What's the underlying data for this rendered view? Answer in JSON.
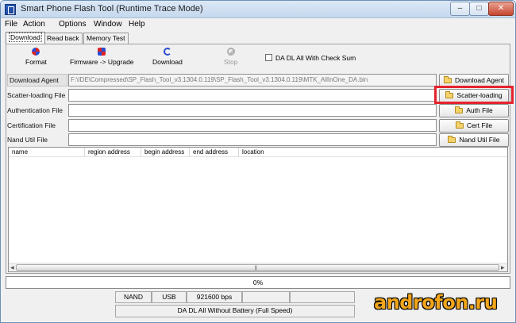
{
  "window": {
    "title": "Smart Phone Flash Tool (Runtime Trace Mode)",
    "minimize_glyph": "–",
    "maximize_glyph": "□",
    "close_glyph": "✕"
  },
  "menu": [
    "File",
    "Action",
    "Options",
    "Window",
    "Help"
  ],
  "tabs": [
    "Download",
    "Read back",
    "Memory Test"
  ],
  "toolbar": {
    "format": "Format",
    "firmware_upgrade": "Firmware -> Upgrade",
    "download": "Download",
    "stop": "Stop",
    "checksum_label": "DA DL All With Check Sum"
  },
  "files": {
    "download_agent": {
      "label": "Download Agent",
      "value": "F:\\IDE\\Compressed\\SP_Flash_Tool_v3.1304.0.119\\SP_Flash_Tool_v3.1304.0.119\\MTK_AllInOne_DA.bin",
      "button": "Download Agent"
    },
    "scatter": {
      "label": "Scatter-loading File",
      "value": "",
      "button": "Scatter-loading"
    },
    "auth": {
      "label": "Authentication File",
      "value": "",
      "button": "Auth File"
    },
    "cert": {
      "label": "Certification File",
      "value": "",
      "button": "Cert File"
    },
    "nand": {
      "label": "Nand Util File",
      "value": "",
      "button": "Nand Util File"
    }
  },
  "list": {
    "columns": [
      "name",
      "region address",
      "begin address",
      "end address",
      "location"
    ]
  },
  "progress": {
    "value": 0,
    "text": "0%"
  },
  "status": {
    "storage": "NAND",
    "port": "USB",
    "baud": "921600 bps",
    "mode": "DA DL All Without Battery (Full Speed)"
  },
  "watermark": "androfon.ru",
  "colors": {
    "highlight": "#e5232e",
    "watermark": "#f2a51a"
  }
}
